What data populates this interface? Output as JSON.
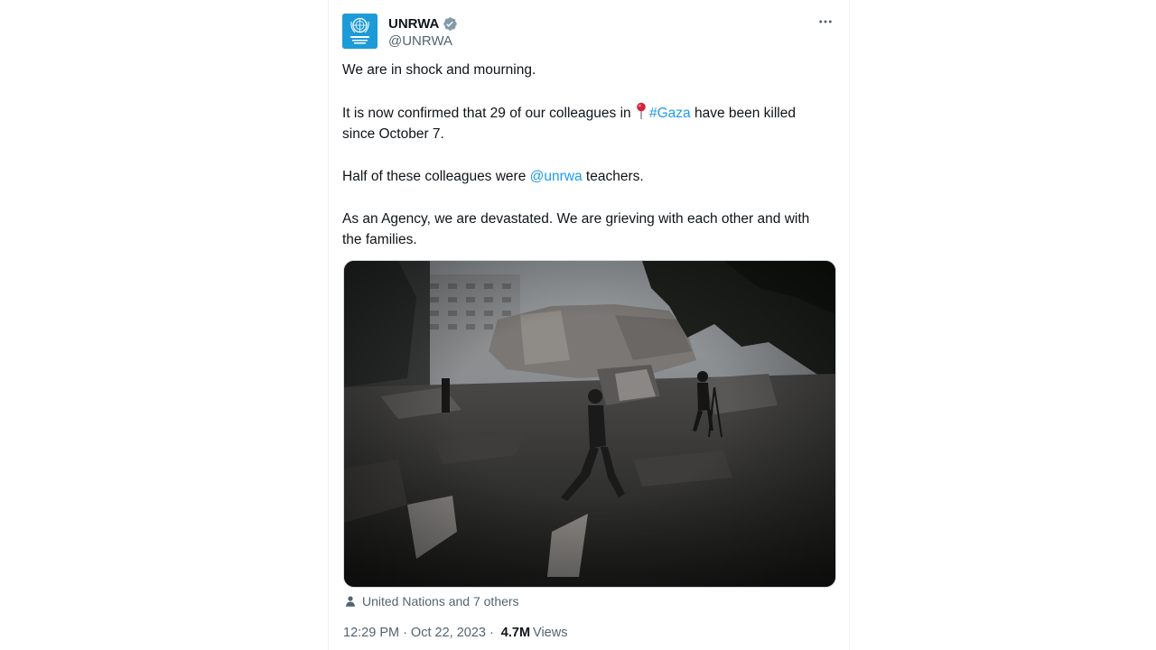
{
  "account": {
    "display_name": "UNRWA",
    "handle": "@UNRWA",
    "avatar_icon": "un-emblem-icon",
    "verified_icon": "verified-badge-icon",
    "avatar_color": "#1d9bd8",
    "verified_color": "#829aab"
  },
  "menu_icon": "more-dots-icon",
  "tweet": {
    "p1": "We are in shock and mourning.",
    "p2_before": "It is now confirmed that 29 of our colleagues in",
    "p2_pin_icon": "round-pushpin-icon",
    "p2_hashtag": "#Gaza",
    "p2_after": "have been killed since October 7.",
    "p3_before": "Half of these colleagues were",
    "p3_mention": "@unrwa",
    "p3_after": "teachers.",
    "p4": "As an Agency, we are devastated. We are grieving with each other and with the families.",
    "link_color": "#1d9bf0"
  },
  "media": {
    "type": "photo"
  },
  "tagged": {
    "icon": "person-icon",
    "text": "United Nations and 7 others"
  },
  "meta": {
    "time": "12:29 PM",
    "separator1": "·",
    "date": "Oct 22, 2023",
    "separator2": "·",
    "views_count": "4.7M",
    "views_label": "Views"
  }
}
